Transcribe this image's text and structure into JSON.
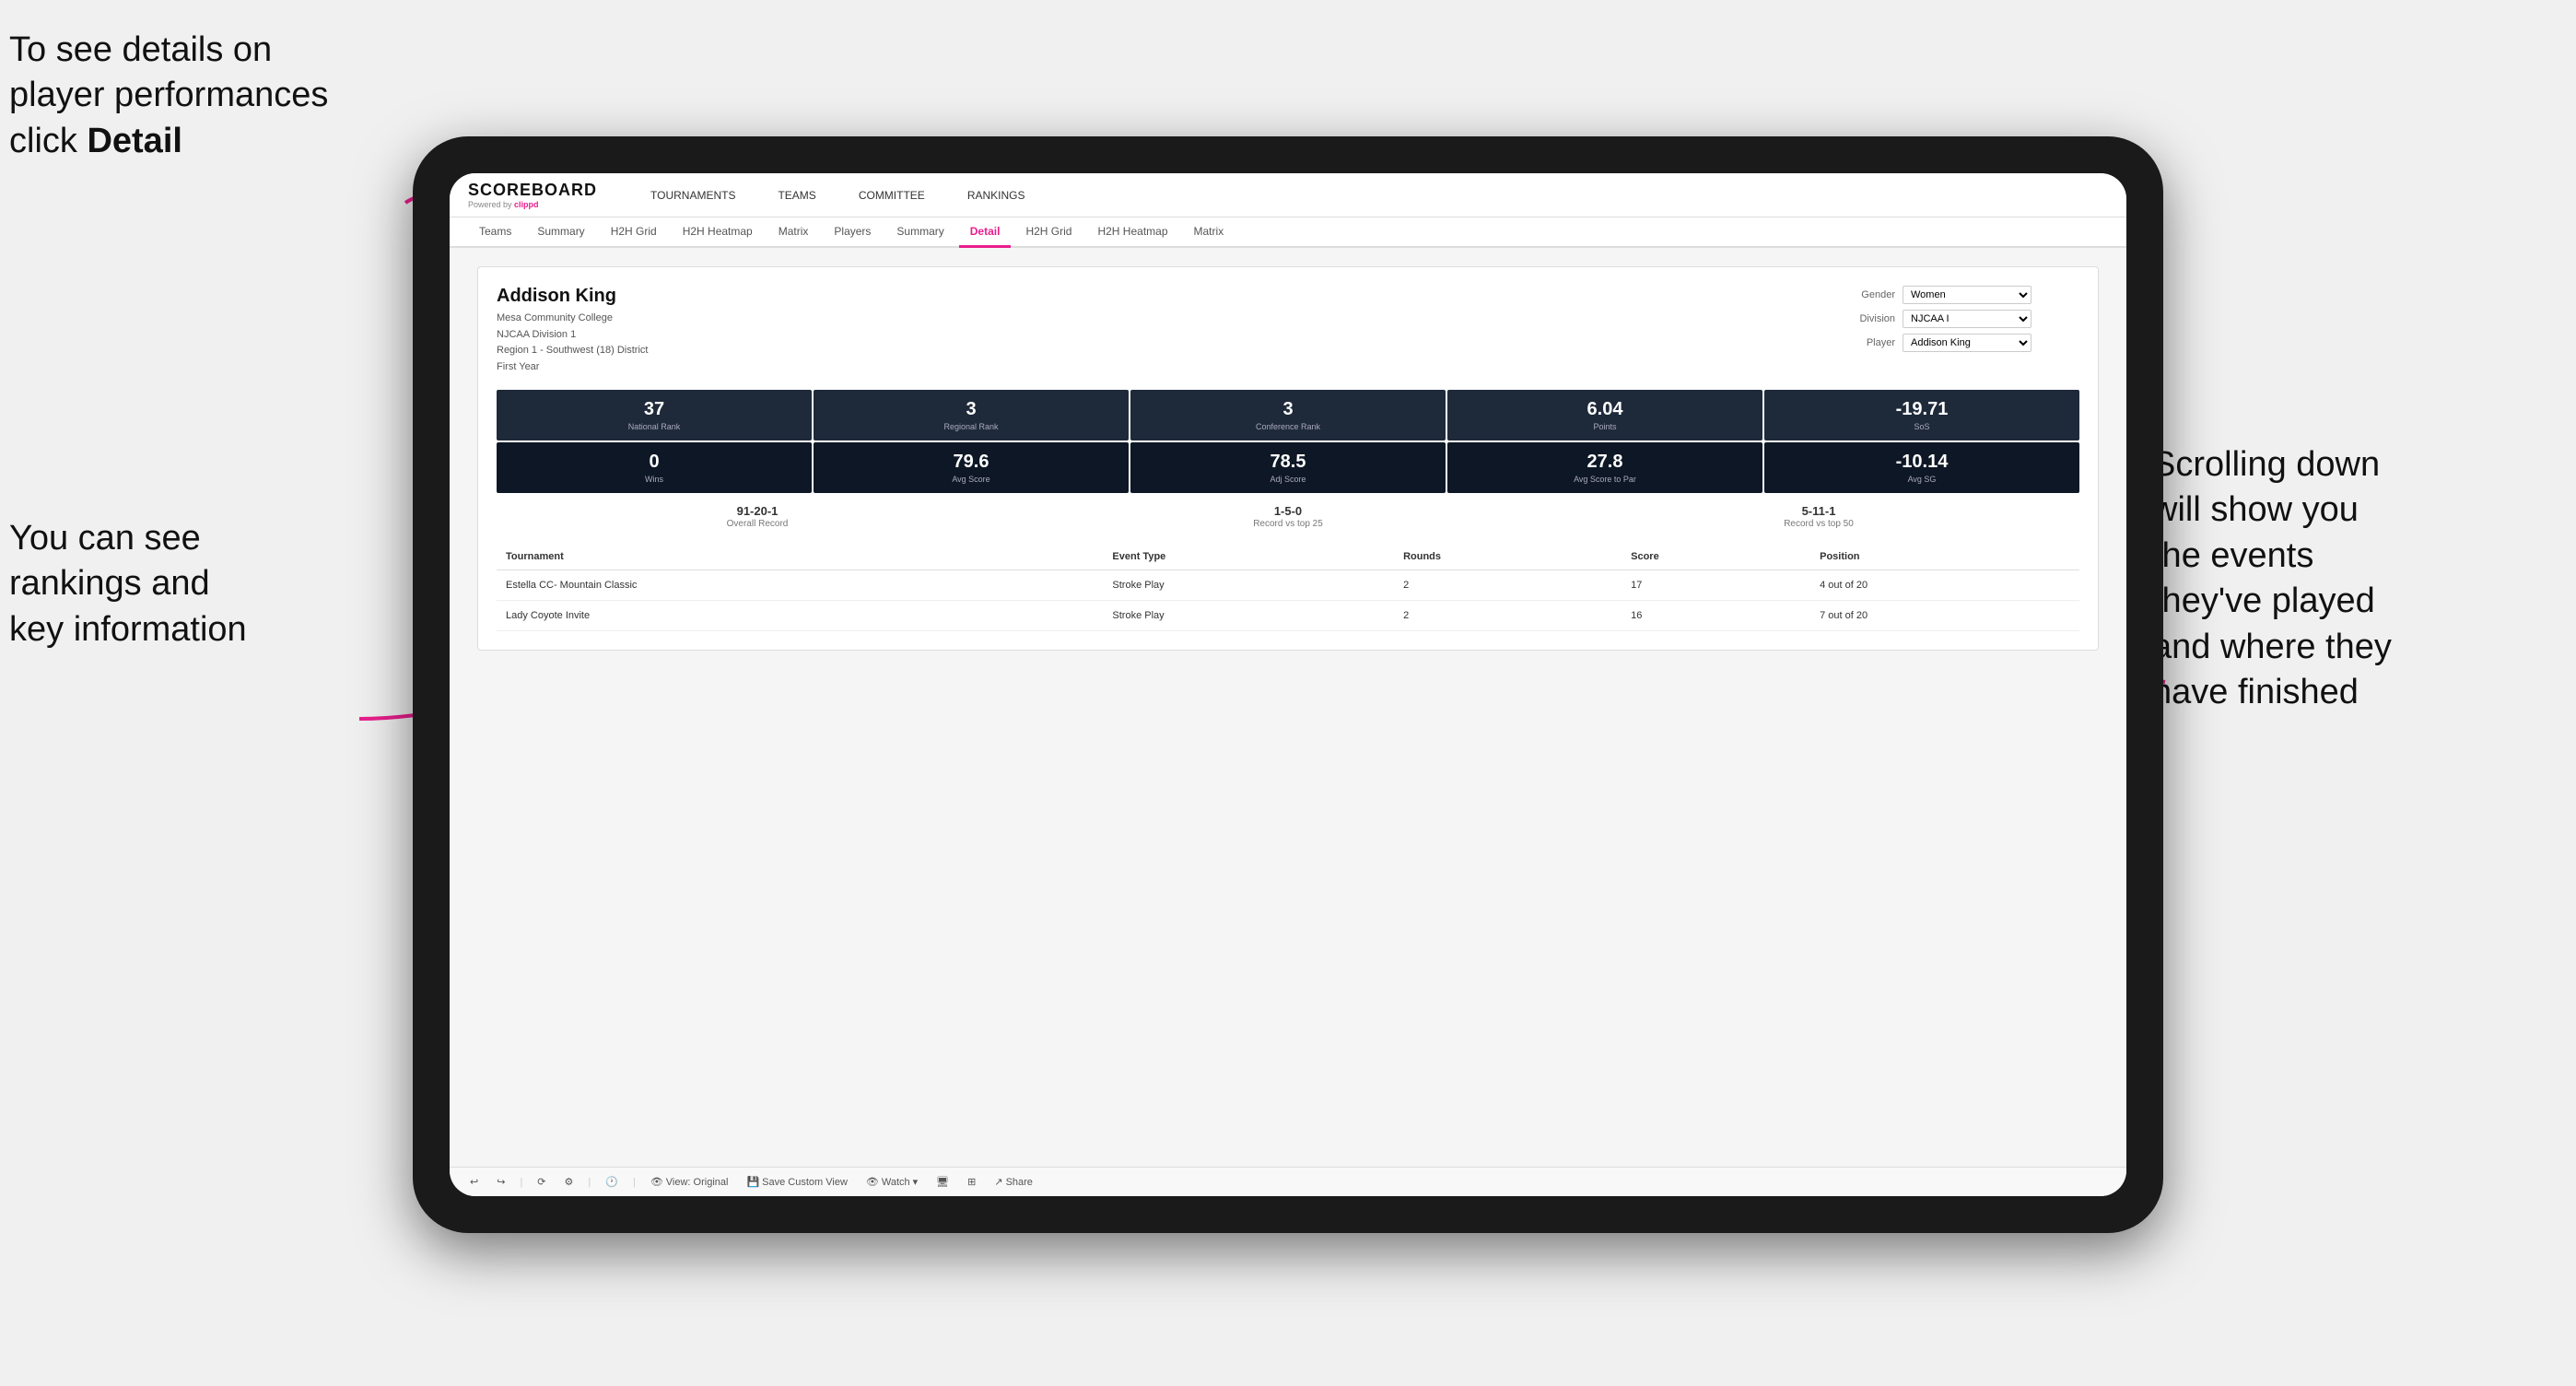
{
  "annotations": {
    "top_left": {
      "line1": "To see details on",
      "line2": "player performances",
      "line3_pre": "click ",
      "line3_bold": "Detail"
    },
    "bottom_left": {
      "line1": "You can see",
      "line2": "rankings and",
      "line3": "key information"
    },
    "right": {
      "line1": "Scrolling down",
      "line2": "will show you",
      "line3": "the events",
      "line4": "they've played",
      "line5": "and where they",
      "line6": "have finished"
    }
  },
  "logo": {
    "scoreboard": "SCOREBOARD",
    "powered": "Powered by",
    "clippd": "clippd"
  },
  "nav": {
    "items": [
      "TOURNAMENTS",
      "TEAMS",
      "COMMITTEE",
      "RANKINGS"
    ]
  },
  "sub_tabs": {
    "items": [
      "Teams",
      "Summary",
      "H2H Grid",
      "H2H Heatmap",
      "Matrix",
      "Players",
      "Summary",
      "Detail",
      "H2H Grid",
      "H2H Heatmap",
      "Matrix"
    ],
    "active": "Detail"
  },
  "player": {
    "name": "Addison King",
    "college": "Mesa Community College",
    "division": "NJCAA Division 1",
    "region": "Region 1 - Southwest (18) District",
    "year": "First Year"
  },
  "controls": {
    "gender_label": "Gender",
    "gender_value": "Women",
    "division_label": "Division",
    "division_value": "NJCAA I",
    "player_label": "Player",
    "player_value": "Addison King"
  },
  "stats_row1": [
    {
      "value": "37",
      "label": "National Rank"
    },
    {
      "value": "3",
      "label": "Regional Rank"
    },
    {
      "value": "3",
      "label": "Conference Rank"
    },
    {
      "value": "6.04",
      "label": "Points"
    },
    {
      "value": "-19.71",
      "label": "SoS"
    }
  ],
  "stats_row2": [
    {
      "value": "0",
      "label": "Wins"
    },
    {
      "value": "79.6",
      "label": "Avg Score"
    },
    {
      "value": "78.5",
      "label": "Adj Score"
    },
    {
      "value": "27.8",
      "label": "Avg Score to Par"
    },
    {
      "value": "-10.14",
      "label": "Avg SG"
    }
  ],
  "records": [
    {
      "value": "91-20-1",
      "label": "Overall Record"
    },
    {
      "value": "1-5-0",
      "label": "Record vs top 25"
    },
    {
      "value": "5-11-1",
      "label": "Record vs top 50"
    }
  ],
  "table": {
    "headers": [
      "Tournament",
      "Event Type",
      "Rounds",
      "Score",
      "Position"
    ],
    "rows": [
      {
        "tournament": "Estella CC- Mountain Classic",
        "event_type": "Stroke Play",
        "rounds": "2",
        "score": "17",
        "position": "4 out of 20"
      },
      {
        "tournament": "Lady Coyote Invite",
        "event_type": "Stroke Play",
        "rounds": "2",
        "score": "16",
        "position": "7 out of 20"
      }
    ]
  },
  "toolbar": {
    "view_label": "View: Original",
    "save_label": "Save Custom View",
    "watch_label": "Watch",
    "share_label": "Share"
  }
}
